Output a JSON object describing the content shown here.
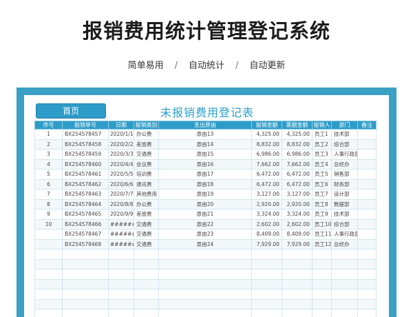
{
  "header": {
    "title": "报销费用统计管理登记系统",
    "subtitle": [
      "简单易用",
      "自动统计",
      "自动更新"
    ],
    "separator": "/"
  },
  "sheet": {
    "home_button": "首页",
    "title": "未报销费用登记表",
    "columns": [
      "序号",
      "报销单号",
      "日期",
      "报销类别",
      "支出原由",
      "报销金额",
      "票据金额",
      "报销人",
      "部门",
      "备注"
    ],
    "rows": [
      [
        "1",
        "BX254578457",
        "2020/1/1",
        "办公费",
        "原由13",
        "4,325.00",
        "4,325.00",
        "员工1",
        "技术部",
        ""
      ],
      [
        "2",
        "BX254578458",
        "2020/2/2",
        "差旅费",
        "原由14",
        "8,832.00",
        "8,832.00",
        "员工2",
        "综合部",
        ""
      ],
      [
        "3",
        "BX254578459",
        "2020/3/3",
        "交通费",
        "原由15",
        "6,986.00",
        "6,986.00",
        "员工3",
        "人事行政部",
        ""
      ],
      [
        "4",
        "BX254578460",
        "2020/4/4",
        "会议费",
        "原由16",
        "7,662.00",
        "7,662.00",
        "员工4",
        "总经办",
        ""
      ],
      [
        "5",
        "BX254578461",
        "2020/5/5",
        "培训费",
        "原由17",
        "6,472.00",
        "6,472.00",
        "员工5",
        "销售部",
        ""
      ],
      [
        "6",
        "BX254578462",
        "2020/6/6",
        "通讯费",
        "原由18",
        "6,472.00",
        "6,472.00",
        "员工6",
        "财务部",
        ""
      ],
      [
        "7",
        "BX254578463",
        "2020/7/7",
        "其他费用",
        "原由19",
        "3,127.00",
        "3,127.00",
        "员工7",
        "设计部",
        ""
      ],
      [
        "8",
        "BX254578464",
        "2020/8/8",
        "办公费",
        "原由20",
        "2,920.00",
        "2,920.00",
        "员工8",
        "数据部",
        ""
      ],
      [
        "9",
        "BX254578465",
        "2020/9/9",
        "差旅费",
        "原由21",
        "3,324.00",
        "3,324.00",
        "员工9",
        "技术部",
        ""
      ],
      [
        "10",
        "BX254578466",
        "#########",
        "交通费",
        "原由22",
        "2,602.00",
        "2,602.00",
        "员工10",
        "综合部",
        ""
      ],
      [
        "",
        "BX254578467",
        "#########",
        "交通费",
        "原由23",
        "8,409.00",
        "8,409.00",
        "员工11",
        "人事行政部",
        ""
      ],
      [
        "",
        "BX254578468",
        "#########",
        "交通费",
        "原由24",
        "7,929.00",
        "7,929.00",
        "员工12",
        "总经办",
        ""
      ],
      [
        "",
        "",
        "",
        "",
        "",
        "",
        "",
        "",
        "",
        ""
      ],
      [
        "",
        "",
        "",
        "",
        "",
        "",
        "",
        "",
        "",
        ""
      ],
      [
        "",
        "",
        "",
        "",
        "",
        "",
        "",
        "",
        "",
        ""
      ],
      [
        "",
        "",
        "",
        "",
        "",
        "",
        "",
        "",
        "",
        ""
      ],
      [
        "",
        "",
        "",
        "",
        "",
        "",
        "",
        "",
        "",
        ""
      ],
      [
        "",
        "",
        "",
        "",
        "",
        "",
        "",
        "",
        "",
        ""
      ],
      [
        "",
        "",
        "",
        "",
        "",
        "",
        "",
        "",
        "",
        ""
      ]
    ]
  },
  "colors": {
    "frame": "#3aa0c4",
    "header_bg": "#2e9cc8",
    "title_text": "#2b9fcb"
  }
}
